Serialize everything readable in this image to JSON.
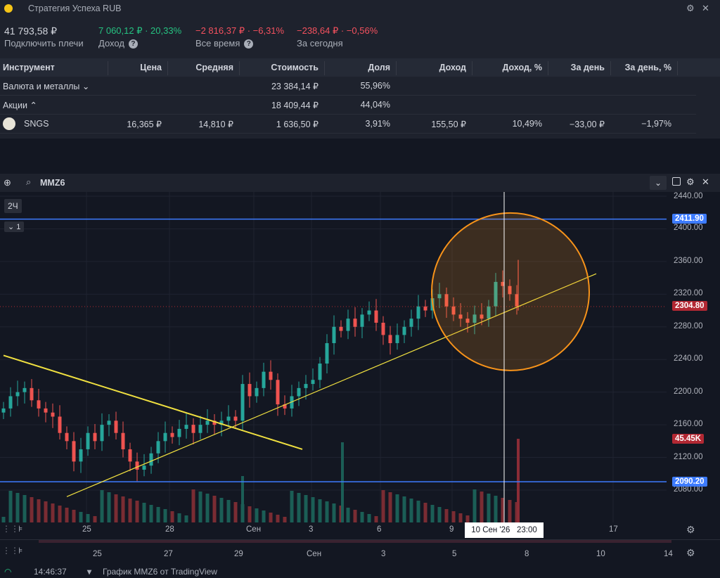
{
  "window": {
    "title": "Стратегия Успеха RUB"
  },
  "summary": {
    "total": "41 793,58 ₽",
    "leverage_link": "Подключить плечи",
    "income": "7 060,12 ₽ · 20,33%",
    "income_label": "Доход",
    "all_time": "−2 816,37 ₽ · −6,31%",
    "all_time_label": "Все время",
    "today": "−238,64 ₽ · −0,56%",
    "today_label": "За сегодня"
  },
  "table": {
    "headers": [
      "Инструмент",
      "Цена",
      "Средняя",
      "Стоимость",
      "Доля",
      "Доход",
      "Доход, %",
      "За день",
      "За день, %"
    ],
    "groups": [
      {
        "name": "Валюта и металлы",
        "value": "23 384,14 ₽",
        "share": "55,96%"
      },
      {
        "name": "Акции",
        "value": "18 409,44 ₽",
        "share": "44,04%"
      }
    ],
    "row": {
      "ticker": "SNGS",
      "price": "16,365 ₽",
      "avg": "14,810 ₽",
      "value": "1 636,50 ₽",
      "share": "3,91%",
      "income": "155,50 ₽",
      "income_pct": "10,49%",
      "day": "−33,00 ₽",
      "day_pct": "−1,97%"
    }
  },
  "chart": {
    "symbol": "MMZ6",
    "interval": "2Ч",
    "layer": "1",
    "price_labels": [
      "2440.00",
      "2400.00",
      "2360.00",
      "2320.00",
      "2280.00",
      "2240.00",
      "2200.00",
      "2160.00",
      "2120.00",
      "2080.00"
    ],
    "hline_top": "2411.90",
    "hline_bottom": "2090.20",
    "last_price": "2304.80",
    "volume": "45.45K",
    "x_labels": [
      "25",
      "28",
      "Сен",
      "3",
      "6",
      "9",
      "17"
    ],
    "crosshair": "10 Сен '26   23:00",
    "nav_labels": [
      "25",
      "27",
      "29",
      "Сен",
      "3",
      "5",
      "8",
      "10",
      "14"
    ],
    "colors": {
      "up": "#26a69a",
      "down": "#ef5350",
      "line": "#3d7bff",
      "trend": "#f0e040",
      "circle": "#f7931a"
    }
  },
  "status": {
    "time": "14:46:37",
    "source": "График MMZ6 от TradingView"
  }
}
